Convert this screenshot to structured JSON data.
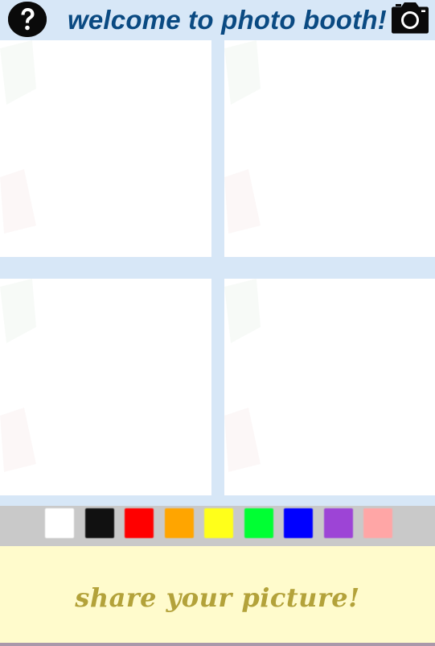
{
  "header": {
    "title": "welcome to photo booth!",
    "help_icon": "question-circle-icon",
    "camera_icon": "camera-icon"
  },
  "photos": [
    {
      "slot": "top-left"
    },
    {
      "slot": "top-right"
    },
    {
      "slot": "bottom-left"
    },
    {
      "slot": "bottom-right"
    }
  ],
  "palette": {
    "colors": [
      "#ffffff",
      "#111111",
      "#ff0000",
      "#ffa500",
      "#ffff1a",
      "#00ff33",
      "#0000ff",
      "#9d44d6",
      "#ffa6a6"
    ]
  },
  "share": {
    "label": "share your picture!"
  },
  "colors": {
    "header_bg": "#d7e7f7",
    "title": "#0a4a82",
    "palette_bg": "#c9c9c9",
    "share_bg": "#fffbcc",
    "share_text": "#b3a23a"
  }
}
